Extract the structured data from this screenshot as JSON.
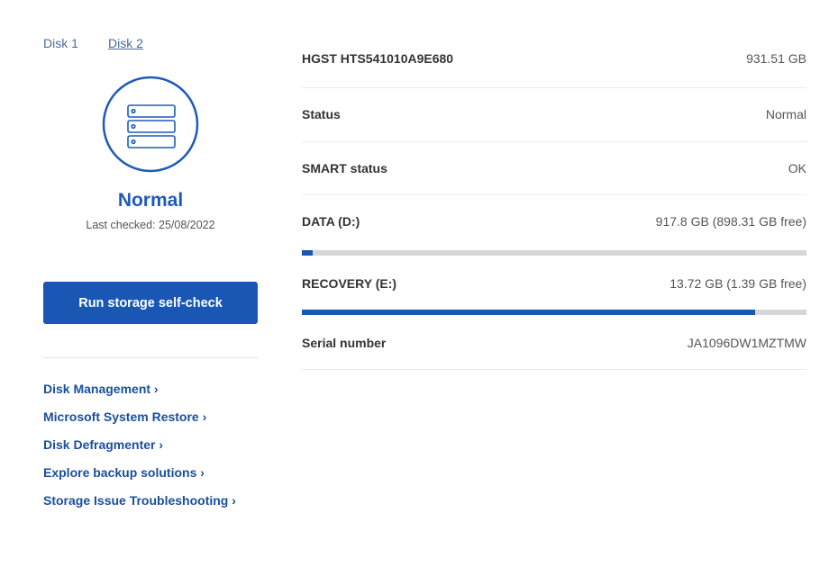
{
  "tabs": [
    {
      "label": "Disk 1"
    },
    {
      "label": "Disk 2"
    }
  ],
  "status": {
    "title": "Normal",
    "last_checked": "Last checked: 25/08/2022"
  },
  "run_button": "Run storage self-check",
  "links": [
    "Disk Management ›",
    "Microsoft System Restore ›",
    "Disk Defragmenter ›",
    "Explore backup solutions ›",
    "Storage Issue Troubleshooting ›"
  ],
  "details": {
    "model": {
      "label": "HGST HTS541010A9E680",
      "value": "931.51 GB"
    },
    "status": {
      "label": "Status",
      "value": "Normal"
    },
    "smart": {
      "label": "SMART status",
      "value": "OK"
    },
    "data": {
      "label": "DATA (D:)",
      "value": "917.8 GB (898.31 GB free)",
      "used_percent": 2.1
    },
    "recovery": {
      "label": "RECOVERY (E:)",
      "value": "13.72 GB (1.39 GB free)",
      "used_percent": 89.9
    },
    "serial": {
      "label": "Serial number",
      "value": "JA1096DW1MZTMW"
    }
  },
  "colors": {
    "accent": "#1a57b5",
    "track": "#d6d6d6"
  }
}
